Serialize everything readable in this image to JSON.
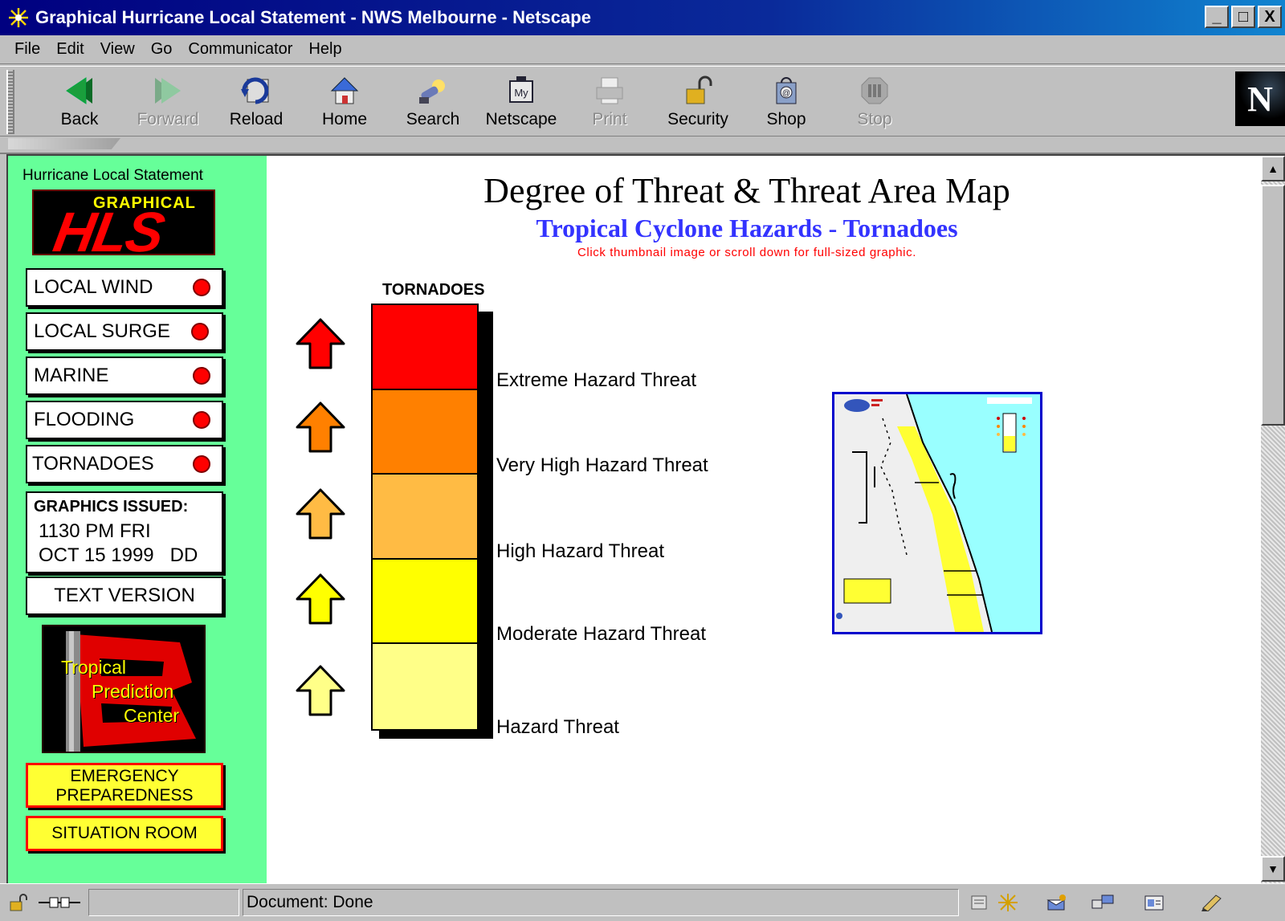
{
  "window": {
    "title": "Graphical Hurricane Local Statement - NWS Melbourne - Netscape",
    "controls": [
      "_",
      "□",
      "X"
    ]
  },
  "menu": [
    "File",
    "Edit",
    "View",
    "Go",
    "Communicator",
    "Help"
  ],
  "toolbar": [
    {
      "label": "Back",
      "icon": "back-arrow-icon",
      "enabled": true
    },
    {
      "label": "Forward",
      "icon": "forward-arrow-icon",
      "enabled": false
    },
    {
      "label": "Reload",
      "icon": "reload-icon",
      "enabled": true
    },
    {
      "label": "Home",
      "icon": "home-icon",
      "enabled": true
    },
    {
      "label": "Search",
      "icon": "search-icon",
      "enabled": true
    },
    {
      "label": "Netscape",
      "icon": "my-netscape-icon",
      "enabled": true
    },
    {
      "label": "Print",
      "icon": "print-icon",
      "enabled": false
    },
    {
      "label": "Security",
      "icon": "lock-icon",
      "enabled": true
    },
    {
      "label": "Shop",
      "icon": "shop-icon",
      "enabled": true
    },
    {
      "label": "Stop",
      "icon": "stop-icon",
      "enabled": false
    }
  ],
  "throbber": "N",
  "sidebar": {
    "heading": "Hurricane Local Statement",
    "logo": {
      "top": "GRAPHICAL",
      "main": "HLS"
    },
    "nav": [
      {
        "label": "LOCAL WIND",
        "status_color": "#ff0000"
      },
      {
        "label": "LOCAL SURGE",
        "status_color": "#ff0000"
      },
      {
        "label": "MARINE",
        "status_color": "#ff0000"
      },
      {
        "label": "FLOODING",
        "status_color": "#ff0000"
      },
      {
        "label": "TORNADOES",
        "status_color": "#ff0000"
      }
    ],
    "issued": {
      "heading": "GRAPHICS ISSUED:",
      "line1": "1130 PM FRI",
      "line2": "OCT 15 1999   DD"
    },
    "text_version": "TEXT VERSION",
    "tpc_logo": {
      "line1": "Tropical",
      "line2": "Prediction",
      "line3": "Center"
    },
    "emergency": {
      "line1": "EMERGENCY",
      "line2": "PREPAREDNESS"
    },
    "situation": "SITUATION ROOM"
  },
  "main": {
    "title": "Degree of Threat & Threat Area Map",
    "subtitle": "Tropical Cyclone Hazards - Tornadoes",
    "note": "Click thumbnail image or scroll down for full-sized graphic.",
    "scale_title": "TORNADOES",
    "levels": [
      {
        "label": "Extreme Hazard Threat",
        "color": "#ff0000"
      },
      {
        "label": "Very High Hazard Threat",
        "color": "#ff8000"
      },
      {
        "label": "High Hazard Threat",
        "color": "#ffbb44"
      },
      {
        "label": "Moderate Hazard Threat",
        "color": "#ffff00"
      },
      {
        "label": "Hazard Threat",
        "color": "#ffff88"
      }
    ],
    "thumbnail": {
      "name": "tornado-threat-map-thumbnail",
      "water_color": "#99ffff",
      "threat_color": "#ffff33"
    }
  },
  "status": {
    "text": "Document: Done"
  }
}
